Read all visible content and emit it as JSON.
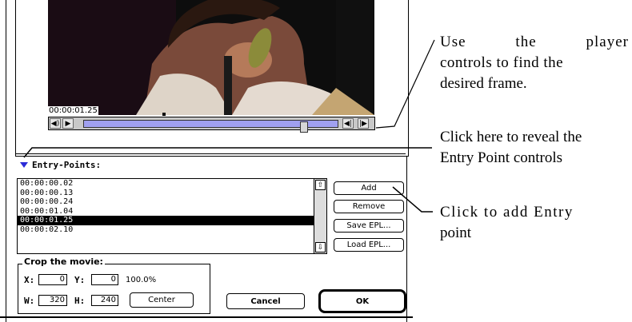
{
  "player": {
    "timecode": "00:00:01.25",
    "position_fraction": 0.88,
    "controls": {
      "volume_icon": "speaker-icon",
      "play_icon": "play-icon",
      "step_back_icon": "step-back-icon",
      "step_forward_icon": "step-forward-icon"
    }
  },
  "entry_points": {
    "label": "Entry-Points:",
    "items": [
      "00:00:00.02",
      "00:00:00.13",
      "00:00:00.24",
      "00:00:01.04",
      "00:00:01.25",
      "00:00:02.10"
    ],
    "selected_index": 4,
    "buttons": {
      "add": "Add",
      "remove": "Remove",
      "save": "Save EPL...",
      "load": "Load EPL..."
    }
  },
  "crop": {
    "title": "Crop the movie:",
    "x_label": "X:",
    "x_value": "0",
    "y_label": "Y:",
    "y_value": "0",
    "scale": "100.0%",
    "w_label": "W:",
    "w_value": "320",
    "h_label": "H:",
    "h_value": "240",
    "center_button": "Center"
  },
  "dialog": {
    "cancel": "Cancel",
    "ok": "OK"
  },
  "annotations": {
    "player_note": [
      "Use the player",
      "controls to find the",
      "desired frame."
    ],
    "entry_note": [
      "Click here to reveal the",
      "Entry Point controls"
    ],
    "add_note": [
      "Click to add Entry",
      "point"
    ]
  },
  "colors": {
    "slider_track": "#a0a0f0",
    "disclosure": "#2b2bd8",
    "selection": "#000000"
  }
}
